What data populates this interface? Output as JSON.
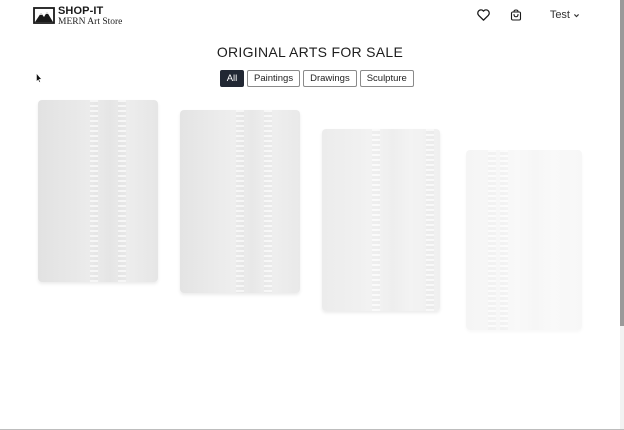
{
  "header": {
    "brand_name": "SHOP-IT",
    "brand_subtitle": "MERN Art Store",
    "logo_icon": "mountain-frame-logo",
    "wishlist_icon": "heart-icon",
    "cart_icon": "shopping-bag-icon",
    "user_name": "Test",
    "user_menu_icon": "chevron-down-icon"
  },
  "main": {
    "title": "ORIGINAL ARTS FOR SALE",
    "filters": [
      {
        "label": "All",
        "active": true
      },
      {
        "label": "Paintings",
        "active": false
      },
      {
        "label": "Drawings",
        "active": false
      },
      {
        "label": "Sculpture",
        "active": false
      }
    ],
    "artworks_loading": 4
  },
  "colors": {
    "active_filter_bg": "#212733",
    "active_filter_text": "#ffffff",
    "placeholder": "#e6e6e6"
  }
}
